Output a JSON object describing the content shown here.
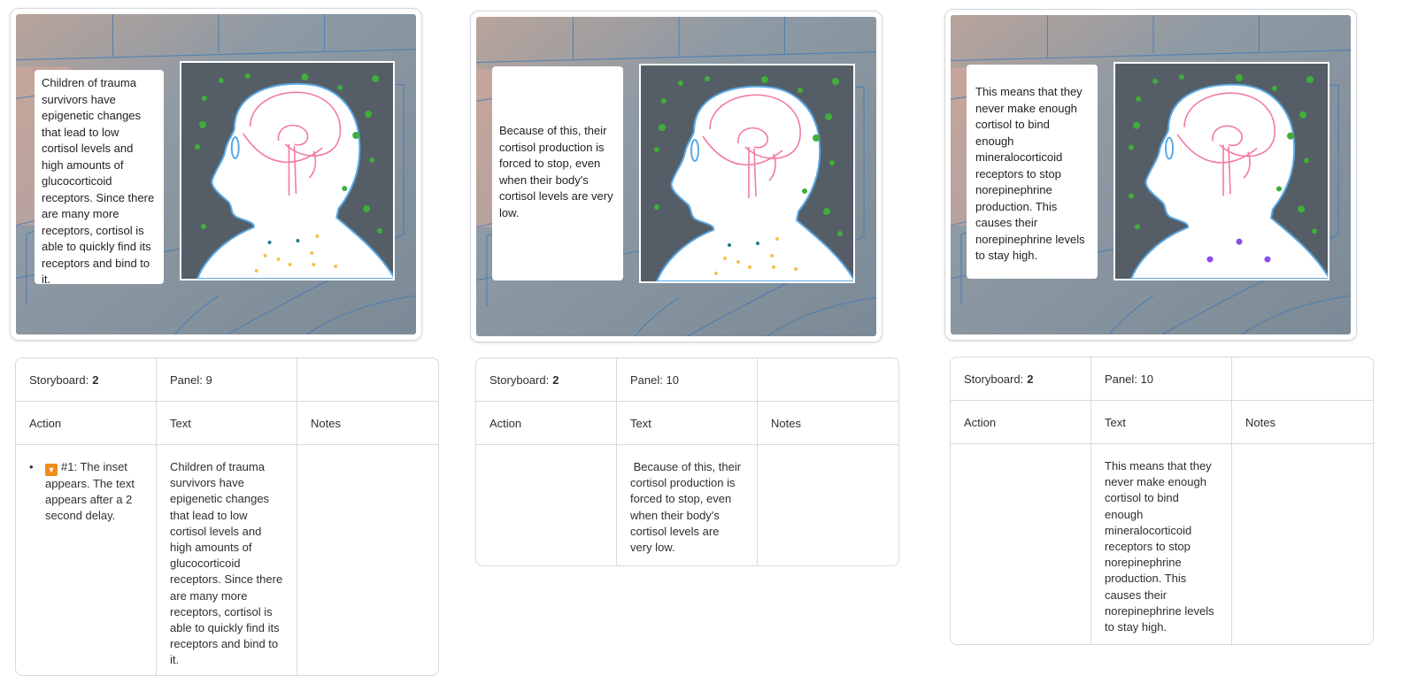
{
  "panels": [
    {
      "caption": "Children of trauma survivors have epigenetic changes that lead to low cortisol levels and high amounts of glucocorticoid receptors. Since there are many more receptors, cortisol is able to quickly find its receptors and bind to it.",
      "storyboard_label": "Storyboard:",
      "storyboard_num": "2",
      "panel_label": "Panel: 9",
      "action_header": "Action",
      "text_header": "Text",
      "notes_header": "Notes",
      "action_text": "#1: The inset appears. The text appears after a 2 second delay.",
      "text_cell": "Children of trauma survivors have epigenetic changes that lead to low cortisol levels and high amounts of glucocorticoid receptors. Since there are many more receptors, cortisol is able to quickly find its receptors and bind to it."
    },
    {
      "caption": " Because of this, their cortisol production is forced to stop, even when their body's cortisol levels are very low.",
      "storyboard_label": "Storyboard:",
      "storyboard_num": "2",
      "panel_label": "Panel: 10",
      "action_header": "Action",
      "text_header": "Text",
      "notes_header": "Notes",
      "action_text": "",
      "text_cell": " Because of this, their cortisol production is forced to stop, even when their body's cortisol levels are very low."
    },
    {
      "caption": "This means that they never make enough cortisol to bind enough mineralocorticoid receptors to stop norepinephrine production. This causes their norepinephrine levels to stay high.",
      "storyboard_label": "Storyboard:",
      "storyboard_num": "2",
      "panel_label": "Panel: 10",
      "action_header": "Action",
      "text_header": "Text",
      "notes_header": "Notes",
      "action_text": "",
      "text_cell": "This means that they never make enough cortisol to bind enough mineralocorticoid receptors to stop norepinephrine production. This causes their norepinephrine levels to stay high."
    }
  ],
  "colors": {
    "scene_bg": "#7f8f9b",
    "inset_bg": "#555e66",
    "green_dot": "#3fae3a",
    "yellow_dot": "#f5c24a",
    "purple_dot": "#8b4cf0",
    "brain": "#f27aa6",
    "outline": "#5aa9e6",
    "badge": "#f08c1a"
  },
  "icons": [
    "play-badge-icon"
  ]
}
